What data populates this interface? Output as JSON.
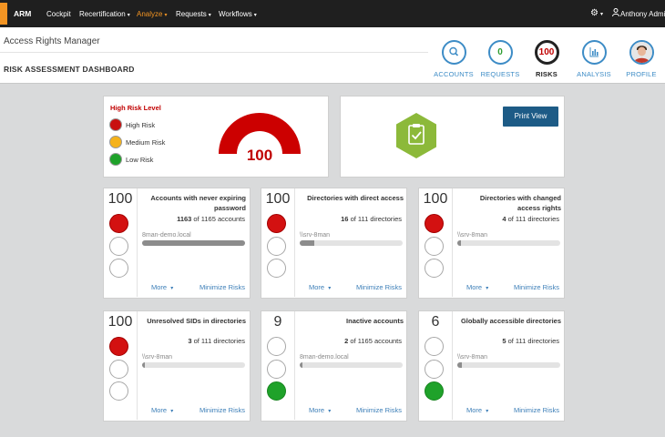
{
  "topnav": {
    "brand": "ARM",
    "items": [
      "Cockpit",
      "Recertification",
      "Analyze",
      "Requests",
      "Workflows"
    ],
    "user": "Anthony Admi",
    "accent": "#f29423"
  },
  "header": {
    "app_title": "Access Rights Manager",
    "page_title": "RISK ASSESSMENT DASHBOARD",
    "nav": [
      {
        "label": "ACCOUNTS",
        "icon": "search-icon"
      },
      {
        "label": "REQUESTS",
        "value": "0"
      },
      {
        "label": "RISKS",
        "value": "100"
      },
      {
        "label": "ANALYSIS",
        "icon": "chart-icon"
      },
      {
        "label": "PROFILE",
        "icon": "avatar"
      }
    ]
  },
  "risk_level": {
    "title": "High Risk Level",
    "legend": [
      {
        "label": "High Risk",
        "color": "#c81010"
      },
      {
        "label": "Medium Risk",
        "color": "#f5b21a"
      },
      {
        "label": "Low Risk",
        "color": "#1fa22a"
      }
    ],
    "gauge_value": "100",
    "gauge_fraction": 1.0
  },
  "actions": {
    "print_label": "Print View",
    "icon": "clipboard-check-icon"
  },
  "cards": [
    {
      "score": "100",
      "level": "high",
      "title": "Accounts with never expiring password",
      "count": "1163",
      "count_rest": " of 1165 accounts",
      "target": "8man-demo.local",
      "fraction": 0.998,
      "more": "More",
      "minimize": "Minimize Risks"
    },
    {
      "score": "100",
      "level": "high",
      "title": "Directories with direct access",
      "count": "16",
      "count_rest": " of 111 directories",
      "target": "\\\\srv-8man",
      "fraction": 0.144,
      "more": "More",
      "minimize": "Minimize Risks"
    },
    {
      "score": "100",
      "level": "high",
      "title": "Directories with changed access rights",
      "count": "4",
      "count_rest": " of 111 directories",
      "target": "\\\\srv-8man",
      "fraction": 0.036,
      "more": "More",
      "minimize": "Minimize Risks"
    },
    {
      "score": "100",
      "level": "high",
      "title": "Unresolved SIDs in directories",
      "count": "3",
      "count_rest": " of 111 directories",
      "target": "\\\\srv-8man",
      "fraction": 0.027,
      "more": "More",
      "minimize": "Minimize Risks"
    },
    {
      "score": "9",
      "level": "low",
      "title": "Inactive accounts",
      "count": "2",
      "count_rest": " of 1165 accounts",
      "target": "8man-demo.local",
      "fraction": 0.002,
      "more": "More",
      "minimize": "Minimize Risks"
    },
    {
      "score": "6",
      "level": "low",
      "title": "Globally accessible directories",
      "count": "5",
      "count_rest": " of 111 directories",
      "target": "\\\\srv-8man",
      "fraction": 0.045,
      "more": "More",
      "minimize": "Minimize Risks"
    }
  ]
}
